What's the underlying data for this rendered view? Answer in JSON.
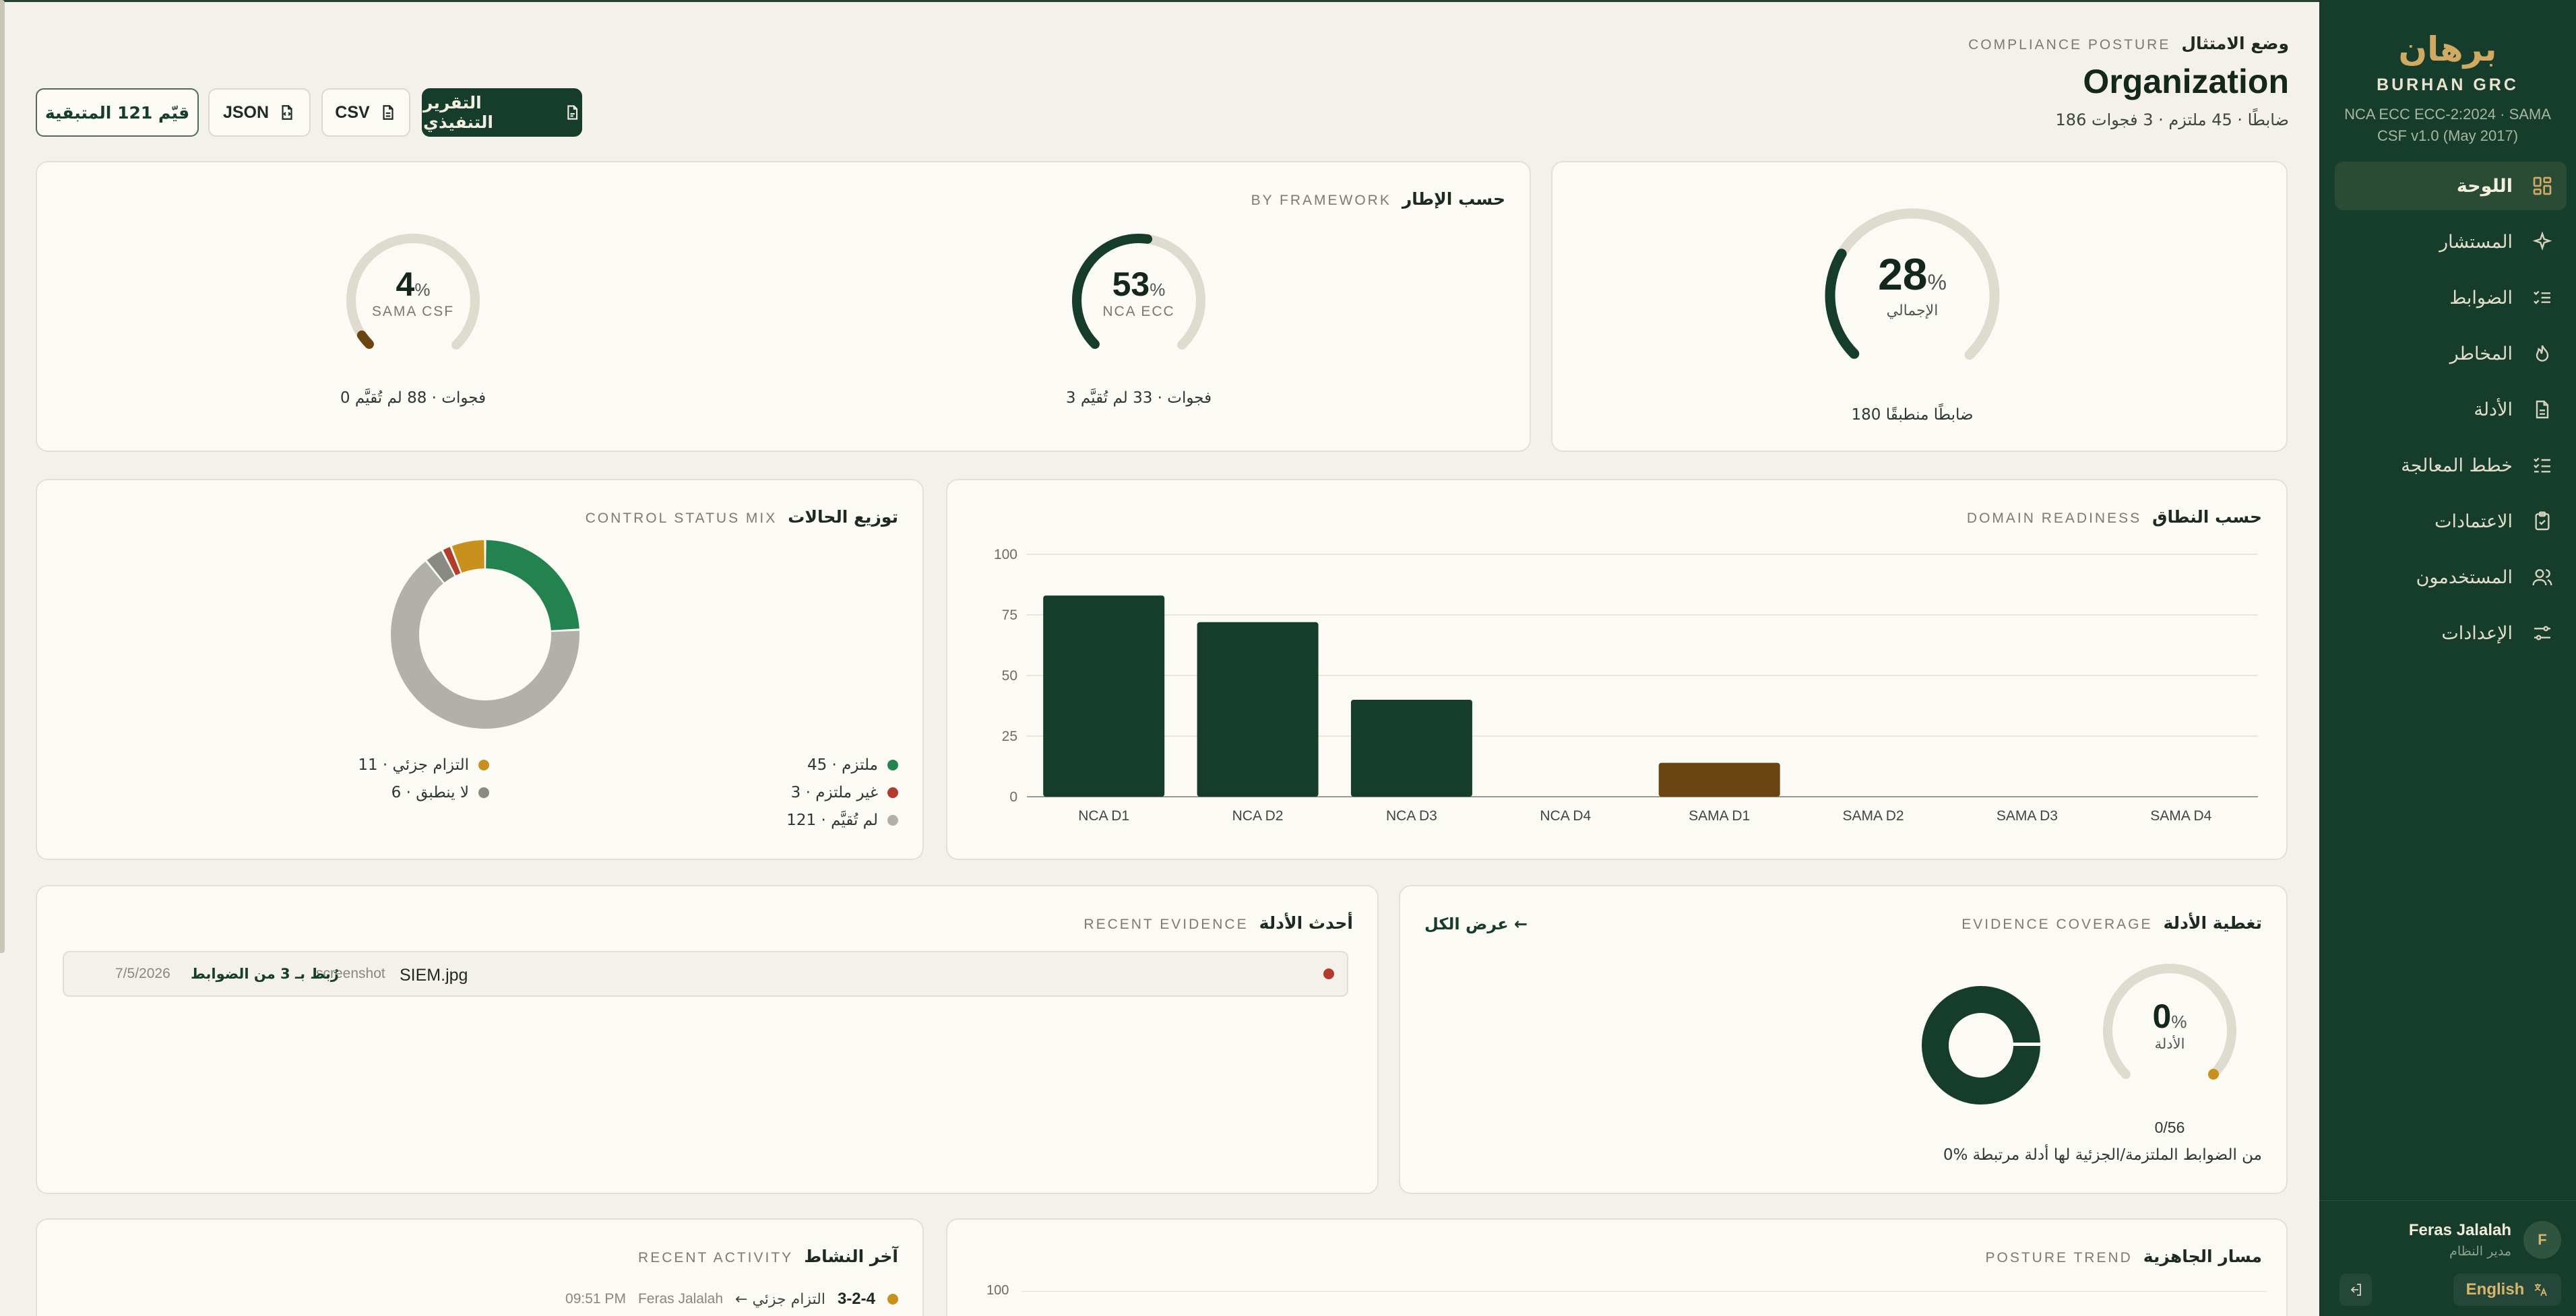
{
  "sidebar": {
    "brand_ar": "برهان",
    "brand_en": "BURHAN GRC",
    "brand_sub": "NCA ECC ECC-2:2024 · SAMA CSF v1.0 (May 2017)",
    "nav": [
      {
        "label": "اللوحة",
        "icon": "dashboard-icon",
        "active": true
      },
      {
        "label": "المستشار",
        "icon": "sparkle-icon"
      },
      {
        "label": "الضوابط",
        "icon": "checklist-icon"
      },
      {
        "label": "المخاطر",
        "icon": "flame-icon"
      },
      {
        "label": "الأدلة",
        "icon": "file-icon"
      },
      {
        "label": "خطط المعالجة",
        "icon": "list-check-icon"
      },
      {
        "label": "الاعتمادات",
        "icon": "clipboard-check-icon"
      },
      {
        "label": "المستخدمون",
        "icon": "users-icon"
      },
      {
        "label": "الإعدادات",
        "icon": "sliders-icon"
      }
    ],
    "user": {
      "initial": "F",
      "name": "Feras Jalalah",
      "role": "مدير النظام"
    },
    "lang_label": "English"
  },
  "header": {
    "eyebrow_ar": "وضع الامتثال",
    "eyebrow_en": "COMPLIANCE POSTURE",
    "title": "Organization",
    "subtitle": "186 ضابطًا · 45 ملتزم · 3 فجوات"
  },
  "actions": {
    "exec_report": "التقرير التنفيذي",
    "csv": "CSV",
    "json": "JSON",
    "remaining": "قيّم 121 المتبقية"
  },
  "overall": {
    "value": 28,
    "pct_sign": "%",
    "caption": "الإجمالي",
    "footer": "180 ضابطًا منطبقًا"
  },
  "by_framework": {
    "title_ar": "حسب الإطار",
    "title_en": "BY FRAMEWORK",
    "items": [
      {
        "name": "NCA ECC",
        "value": 53,
        "footer": "3 فجوات · 33 لم تُقيَّم"
      },
      {
        "name": "SAMA CSF",
        "value": 4,
        "footer": "0 فجوات · 88 لم تُقيَّم"
      }
    ]
  },
  "domain_readiness": {
    "title_ar": "حسب النطاق",
    "title_en": "DOMAIN READINESS"
  },
  "chart_data": {
    "type": "bar",
    "categories": [
      "NCA D1",
      "NCA D2",
      "NCA D3",
      "NCA D4",
      "SAMA D1",
      "SAMA D2",
      "SAMA D3",
      "SAMA D4"
    ],
    "values": [
      83,
      72,
      40,
      0,
      14,
      0,
      0,
      0
    ],
    "colors": [
      "#163d2c",
      "#163d2c",
      "#163d2c",
      "#163d2c",
      "#6b4414",
      "#163d2c",
      "#163d2c",
      "#163d2c"
    ],
    "yticks": [
      0,
      25,
      50,
      75,
      100
    ],
    "ylim": [
      0,
      100
    ],
    "grid": true
  },
  "status_mix": {
    "title_ar": "توزيع الحالات",
    "title_en": "CONTROL STATUS MIX",
    "items": [
      {
        "label": "ملتزم · 45",
        "value": 45,
        "color": "#23834f"
      },
      {
        "label": "غير ملتزم · 3",
        "value": 3,
        "color": "#b23b2b"
      },
      {
        "label": "لم تُقيَّم · 121",
        "value": 121,
        "color": "#b1b1aa"
      },
      {
        "label": "التزام جزئي · 11",
        "value": 11,
        "color": "#c8901d"
      },
      {
        "label": "لا ينطبق · 6",
        "value": 6,
        "color": "#8a8a84"
      }
    ]
  },
  "evidence_coverage": {
    "title_ar": "تغطية الأدلة",
    "title_en": "EVIDENCE COVERAGE",
    "view_all": "عرض الكل ←",
    "value": 0,
    "pct_sign": "%",
    "caption": "الأدلة",
    "ratio": "0/56",
    "footer": "0% من الضوابط الملتزمة/الجزئية لها أدلة مرتبطة"
  },
  "recent_evidence": {
    "title_ar": "أحدث الأدلة",
    "title_en": "RECENT EVIDENCE",
    "items": [
      {
        "name": "SIEM.jpg",
        "type": "screenshot",
        "link": "رُبط بـ 3 من الضوابط",
        "date": "7/5/2026"
      }
    ]
  },
  "posture_trend": {
    "title_ar": "مسار الجاهزية",
    "title_en": "POSTURE TREND",
    "ytop": "100"
  },
  "recent_activity": {
    "title_ar": "آخر النشاط",
    "title_en": "RECENT ACTIVITY",
    "items": [
      {
        "code": "3-2-4",
        "change": "← التزام جزئي",
        "user": "Feras Jalalah",
        "time": "09:51 PM"
      }
    ]
  }
}
